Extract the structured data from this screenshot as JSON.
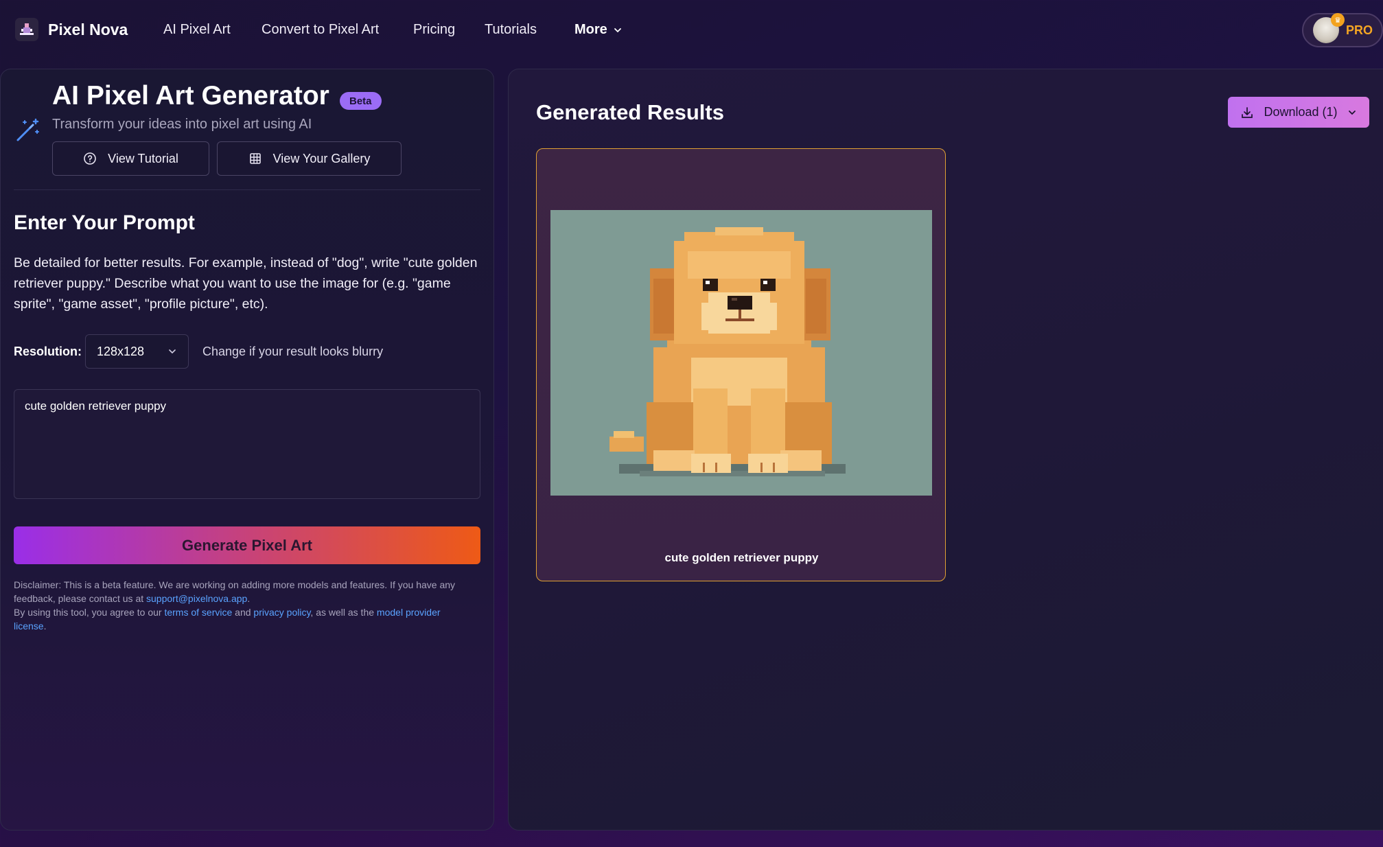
{
  "nav": {
    "brand": "Pixel Nova",
    "links": [
      "AI Pixel Art",
      "Convert to Pixel Art",
      "Pricing",
      "Tutorials"
    ],
    "more": "More",
    "pro": "PRO"
  },
  "generator": {
    "title": "AI Pixel Art Generator",
    "badge": "Beta",
    "subtitle": "Transform your ideas into pixel art using AI",
    "tutorial_button": "View Tutorial",
    "gallery_button": "View Your Gallery",
    "prompt_heading": "Enter Your Prompt",
    "prompt_description": "Be detailed for better results. For example, instead of \"dog\", write \"cute golden retriever puppy.\" Describe what you want to use the image for (e.g. \"game sprite\", \"game asset\", \"profile picture\", etc).",
    "resolution_label": "Resolution:",
    "resolution_value": "128x128",
    "resolution_hint": "Change if your result looks blurry",
    "prompt_value": "cute golden retriever puppy",
    "generate_button": "Generate Pixel Art",
    "disclaimer": {
      "line1": "Disclaimer: This is a beta feature. We are working on adding more models and features. If you have any feedback, please contact us at ",
      "email": "support@pixelnova.app",
      "line1_end": ".",
      "line2": "By using this tool, you agree to our ",
      "terms": "terms of service",
      "and": " and ",
      "privacy": "privacy policy",
      "as_well": ", as well as the ",
      "license": "model provider license",
      "end": "."
    }
  },
  "results": {
    "title": "Generated Results",
    "download_button": "Download (1)",
    "items": [
      {
        "caption": "cute golden retriever puppy"
      }
    ]
  },
  "colors": {
    "accent_purple": "#9b6cf5",
    "card_border": "#e0a133",
    "pro_gold": "#f5a623",
    "link_blue": "#5aa3ff"
  },
  "icons": [
    "app-logo-icon",
    "chevron-down-icon",
    "magic-wand-icon",
    "help-circle-icon",
    "grid-icon",
    "download-icon"
  ]
}
